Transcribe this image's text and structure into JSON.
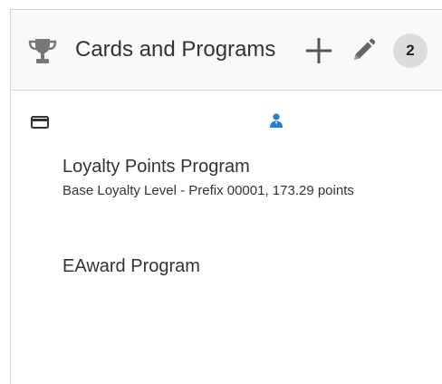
{
  "panel": {
    "title": "Cards and Programs",
    "count_badge": "2",
    "icons": {
      "header": "trophy-icon",
      "add": "plus-icon",
      "edit": "pencil-icon",
      "card": "credit-card-icon",
      "member": "person-icon"
    },
    "accent_color": "#2a7fc7"
  },
  "programs": [
    {
      "name": "Loyalty Points Program",
      "detail": "Base Loyalty Level - Prefix 00001, 173.29 points"
    },
    {
      "name": "EAward Program"
    }
  ]
}
